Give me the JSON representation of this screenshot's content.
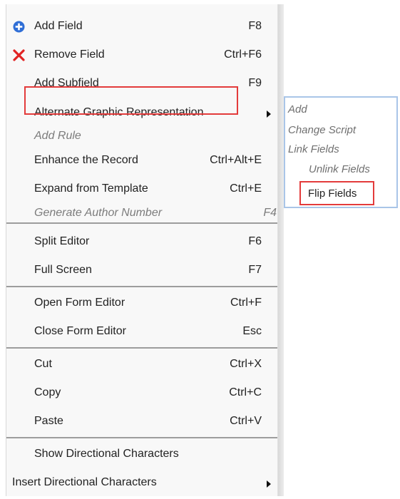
{
  "menu": {
    "items": [
      {
        "label": "Add Field",
        "shortcut": "F8",
        "icon": "add-circle-icon"
      },
      {
        "label": "Remove Field",
        "shortcut": "Ctrl+F6",
        "icon": "remove-x-icon"
      },
      {
        "label": "Add Subfield",
        "shortcut": "F9"
      },
      {
        "label": "Alternate Graphic Representation",
        "shortcut": "",
        "has_submenu": true
      },
      {
        "label": "Add Rule",
        "shortcut": "",
        "disabled": true
      },
      {
        "label": "Enhance the Record",
        "shortcut": "Ctrl+Alt+E"
      },
      {
        "label": "Expand from Template",
        "shortcut": "Ctrl+E"
      },
      {
        "label": "Generate Author Number",
        "shortcut": "F4",
        "disabled": true
      },
      {
        "label": "Split Editor",
        "shortcut": "F6"
      },
      {
        "label": "Full Screen",
        "shortcut": "F7"
      },
      {
        "label": "Open Form Editor",
        "shortcut": "Ctrl+F"
      },
      {
        "label": "Close Form Editor",
        "shortcut": "Esc"
      },
      {
        "label": "Cut",
        "shortcut": "Ctrl+X"
      },
      {
        "label": "Copy",
        "shortcut": "Ctrl+C"
      },
      {
        "label": "Paste",
        "shortcut": "Ctrl+V"
      },
      {
        "label": "Show Directional Characters",
        "shortcut": ""
      },
      {
        "label": "Insert Directional Characters",
        "shortcut": "",
        "has_submenu": true
      }
    ]
  },
  "submenu": {
    "items": [
      {
        "label": "Add",
        "disabled": true
      },
      {
        "label": "Change Script",
        "disabled": true
      },
      {
        "label": "Link Fields",
        "disabled": true
      },
      {
        "label": "Unlink Fields",
        "disabled": true
      },
      {
        "label": "Flip Fields",
        "disabled": false
      }
    ]
  },
  "colors": {
    "highlight": "#e33b3b",
    "submenu_border": "#a9c5e8",
    "add_icon": "#2f6ed6",
    "remove_icon": "#e12424"
  }
}
